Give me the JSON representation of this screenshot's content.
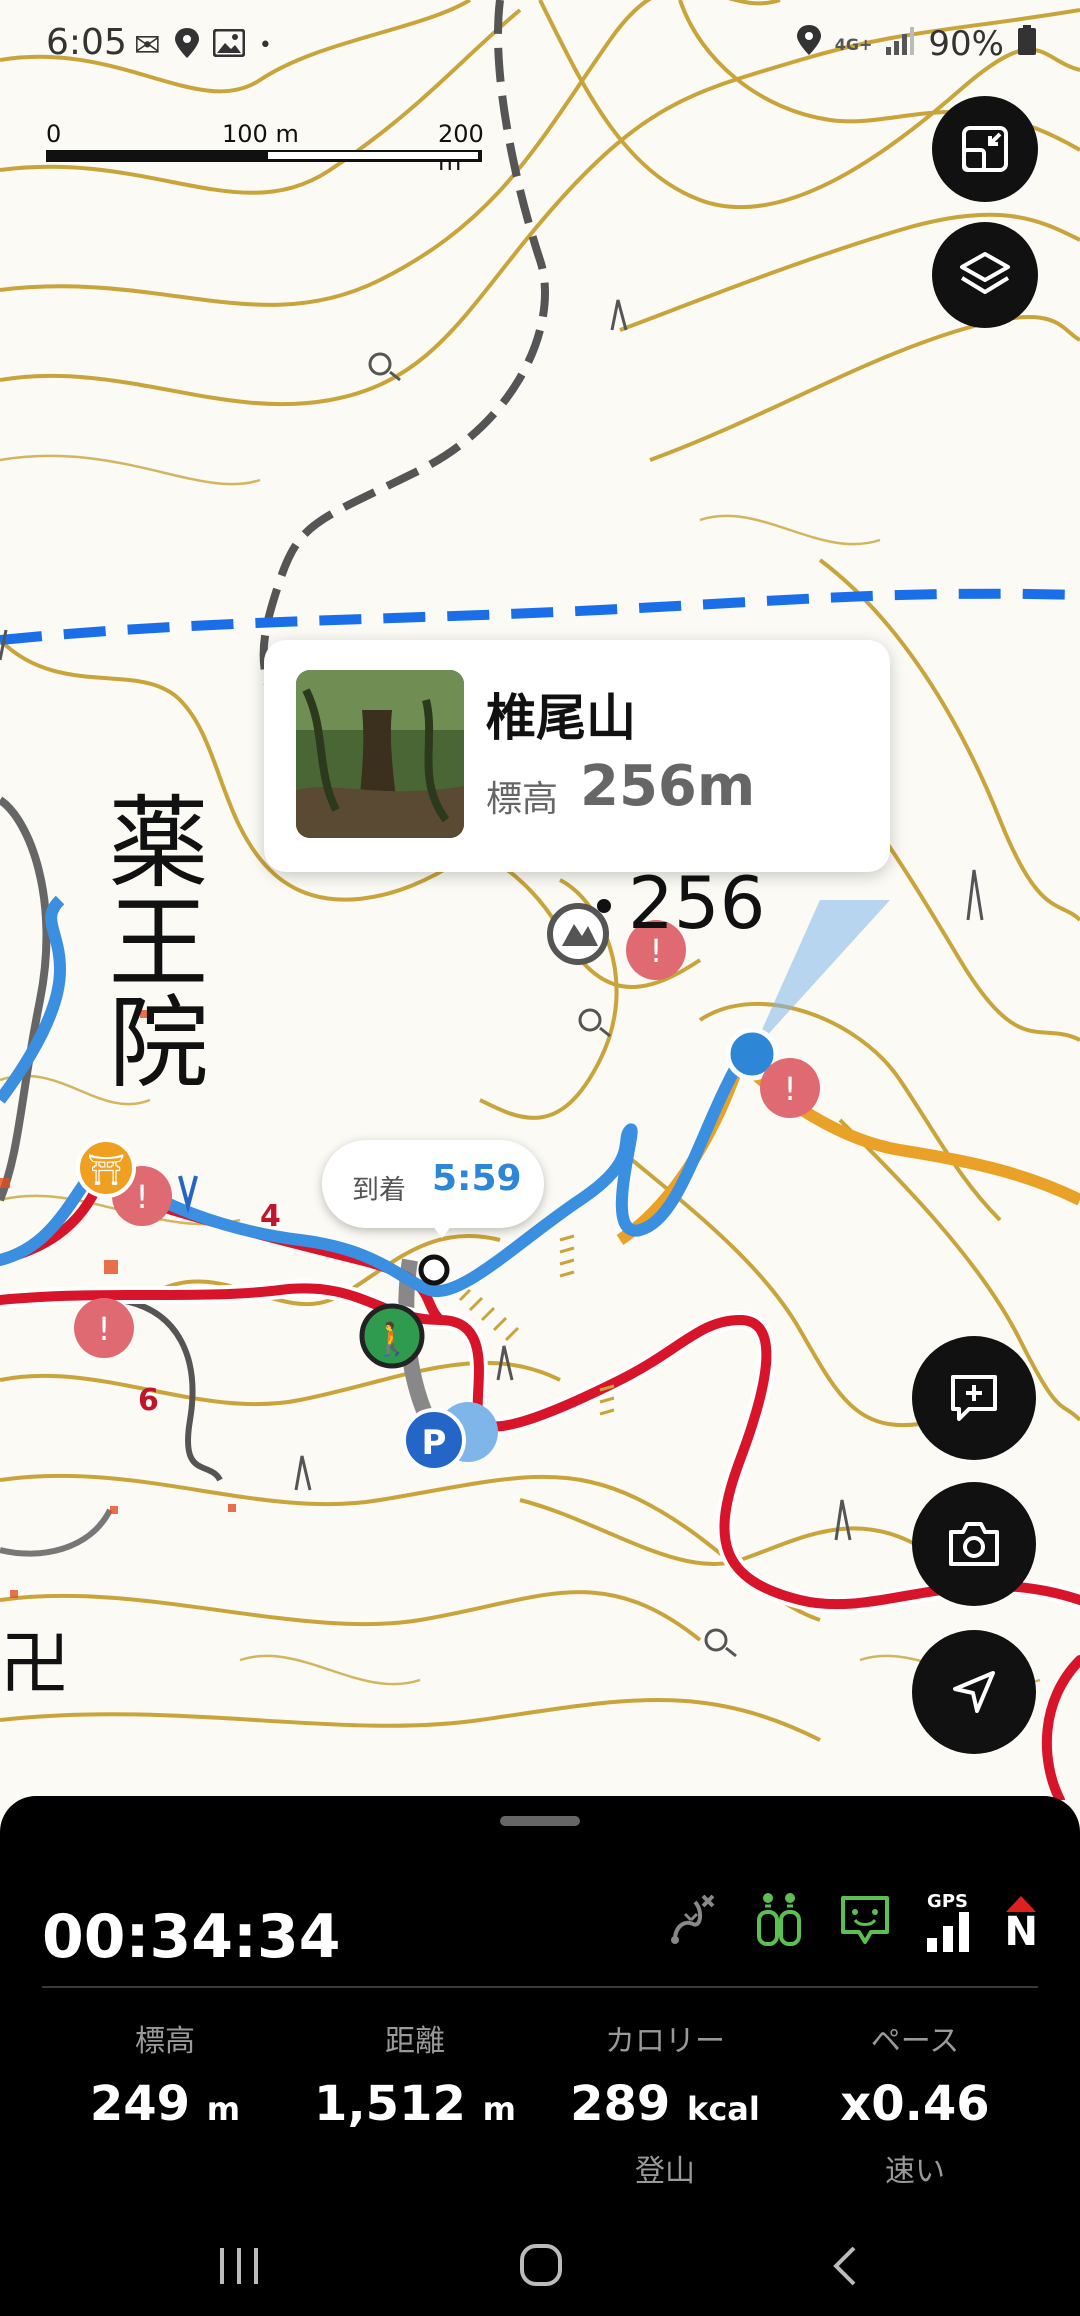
{
  "status_bar": {
    "time": "6:05",
    "network": "4G+",
    "battery": "90%"
  },
  "scale_bar": {
    "labels": [
      "0",
      "100 m",
      "200 m"
    ]
  },
  "map": {
    "place_label": "薬王院",
    "peak_elevation_label": "256",
    "trail_numbers": [
      "4",
      "6"
    ],
    "colors": {
      "contour": "#c9a43a",
      "trail_red": "#d8142b",
      "track_blue": "#3a8fe0",
      "boundary_blue": "#1a6fe8",
      "path_gray": "#555555",
      "orange_route": "#f0a020"
    }
  },
  "peak_popup": {
    "name": "椎尾山",
    "elevation_label": "標高",
    "elevation_value": "256m"
  },
  "arrival": {
    "label": "到着",
    "time": "5:59"
  },
  "fabs": {
    "expand": "expand-icon",
    "layers": "layers-icon",
    "add_note": "add-note-icon",
    "camera": "camera-icon",
    "navigate": "navigate-icon"
  },
  "panel": {
    "timer": "00:34:34",
    "indicators": [
      "route-off-icon",
      "companions-icon",
      "chat-icon",
      "gps-signal-icon",
      "compass-north-icon"
    ],
    "gps_label": "GPS",
    "north_label": "N",
    "stats": [
      {
        "label": "標高",
        "value": "249",
        "unit": "m",
        "sub": ""
      },
      {
        "label": "距離",
        "value": "1,512",
        "unit": "m",
        "sub": ""
      },
      {
        "label": "カロリー",
        "value": "289",
        "unit": "kcal",
        "sub": "登山"
      },
      {
        "label": "ペース",
        "value": "x0.46",
        "unit": "",
        "sub": "速い"
      }
    ]
  }
}
